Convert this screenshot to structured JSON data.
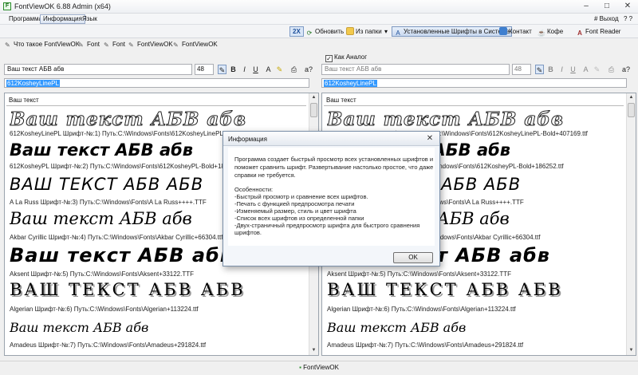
{
  "window": {
    "title": "FontViewOK 6.88 Admin (x64)"
  },
  "menu": {
    "items": [
      "Программа",
      "Информация",
      "Язык"
    ],
    "exit": "# Выход",
    "help": "? ?"
  },
  "toolbar": {
    "zoom": "2X",
    "refresh": "Обновить",
    "from_folder": "Из папки",
    "installed": "Установленные Шрифты в Системе",
    "contact": "Контакт",
    "coffee": "Кофе",
    "font_reader": "Font Reader"
  },
  "quicklinks": [
    "Что такое FontViewOK",
    "Font",
    "Font",
    "FontViewOK",
    "FontViewOK"
  ],
  "left_panel": {
    "sample_text": "Ваш текст АБВ абв",
    "size": "48",
    "font_field": "612KosheyLinePL",
    "list_header": "Ваш текст",
    "entries": [
      {
        "sample": "Ваш текст АБВ абв",
        "caption": "612KosheyLinePL Шрифт-№:1) Путь:C:\\Windows\\Fonts\\612KosheyLinePL-Bold+407169.ttf"
      },
      {
        "sample": "Ваш текст АБВ абв",
        "caption": "612KosheyPL Шрифт-№:2) Путь:C:\\Windows\\Fonts\\612KosheyPL-Bold+186252.ttf"
      },
      {
        "sample": "ВАШ ТЕКСТ АБВ АБВ",
        "caption": "A La Russ Шрифт-№:3) Путь:C:\\Windows\\Fonts\\A La Russ++++.TTF"
      },
      {
        "sample": "Ваш текст АБВ абв",
        "caption": "Akbar Cyrillic Шрифт-№:4) Путь:C:\\Windows\\Fonts\\Akbar Cyrillic+66304.ttf"
      },
      {
        "sample": "Ваш текст АБВ абв",
        "caption": "Aksent Шрифт-№:5) Путь:C:\\Windows\\Fonts\\Aksent+33122.TTF"
      },
      {
        "sample": "ВАШ ТЕКСТ АБВ АБВ",
        "caption": "Algerian Шрифт-№:6) Путь:C:\\Windows\\Fonts\\Algerian+113224.ttf"
      },
      {
        "sample": "Ваш текст АБВ абв",
        "caption": "Amadeus Шрифт-№:7) Путь:C:\\Windows\\Fonts\\Amadeus+291824.ttf"
      }
    ]
  },
  "right_panel": {
    "analog_label": "Как Аналог",
    "sample_text": "Ваш текст АБВ абв",
    "size": "48",
    "font_field": "612KosheyLinePL",
    "list_header": "Ваш текст"
  },
  "dialog": {
    "title": "Информация",
    "lines": [
      "Программа создает быстрый просмотр всех установленных шрифтов и",
      "поможет сравнить шрифт. Развертывание настолько простое, что даже",
      "справки не требуется.",
      "",
      "Особенности:",
      "-Быстрый просмотр и сравнение всех шрифтов.",
      "-Печать с функцией предпросмотра печати",
      "-Изменяемый размер, стиль и цвет шрифта",
      "-Список всех шрифтов из определенной папки",
      "-Двух-страничный предпросмотр шрифта для быстрого сравнения",
      "шрифтов."
    ],
    "ok": "OK"
  },
  "status": {
    "text": "FontViewOK"
  },
  "colors": {
    "selection": "#3399ff",
    "accent": "#7d98c0"
  }
}
